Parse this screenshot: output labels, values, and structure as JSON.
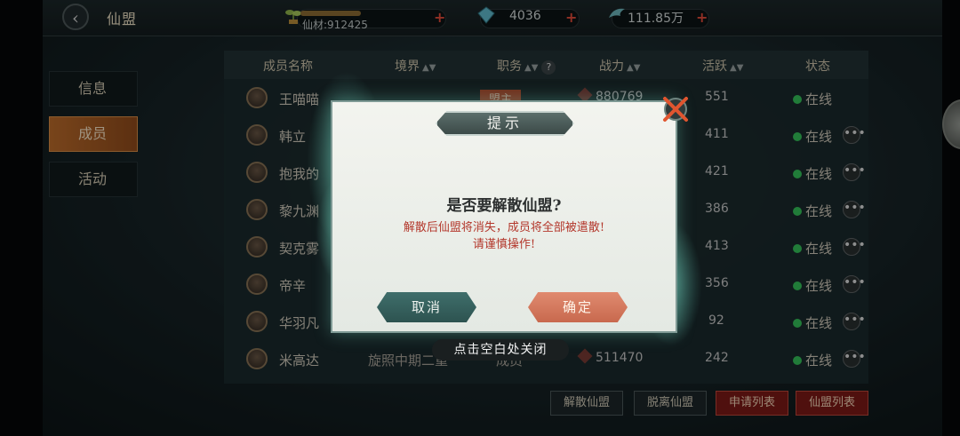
{
  "header": {
    "title": "仙盟",
    "resources": [
      {
        "name": "仙材",
        "value": "仙材:912425",
        "icon": "sprout-icon"
      },
      {
        "name": "gems",
        "value": "4036",
        "icon": "gem-icon"
      },
      {
        "name": "coins",
        "value": "111.85万",
        "icon": "wing-icon"
      }
    ],
    "plus": "+"
  },
  "tabs": [
    {
      "label": "信息",
      "active": false
    },
    {
      "label": "成员",
      "active": true
    },
    {
      "label": "活动",
      "active": false
    }
  ],
  "table": {
    "headers": {
      "name": "成员名称",
      "realm": "境界",
      "role": "职务",
      "power": "战力",
      "active": "活跃",
      "status": "状态"
    },
    "rows": [
      {
        "name": "王喵喵",
        "realm": "",
        "role": "盟主",
        "power": "880769",
        "active": "551",
        "status": "在线",
        "more": false
      },
      {
        "name": "韩立",
        "realm": "",
        "role": "",
        "power": "",
        "active": "411",
        "status": "在线",
        "more": true
      },
      {
        "name": "抱我的",
        "realm": "",
        "role": "",
        "power": "",
        "active": "421",
        "status": "在线",
        "more": true
      },
      {
        "name": "黎九渊",
        "realm": "",
        "role": "",
        "power": "",
        "active": "386",
        "status": "在线",
        "more": true
      },
      {
        "name": "契克雾",
        "realm": "",
        "role": "",
        "power": "",
        "active": "413",
        "status": "在线",
        "more": true
      },
      {
        "name": "帝辛",
        "realm": "",
        "role": "",
        "power": "",
        "active": "356",
        "status": "在线",
        "more": true
      },
      {
        "name": "华羽凡",
        "realm": "",
        "role": "",
        "power": "",
        "active": "92",
        "status": "在线",
        "more": true
      },
      {
        "name": "米高达",
        "realm": "旋照中期二重",
        "role": "成员",
        "power": "511470",
        "active": "242",
        "status": "在线",
        "more": true
      }
    ]
  },
  "bottom_buttons": [
    "解散仙盟",
    "脱离仙盟",
    "申请列表",
    "仙盟列表"
  ],
  "dialog": {
    "title": "提示",
    "question": "是否要解散仙盟?",
    "warning_line1": "解散后仙盟将消失，成员将全部被遣散!",
    "warning_line2": "请谨慎操作!",
    "cancel": "取消",
    "confirm": "确定",
    "close_hint": "点击空白处关闭"
  },
  "colors": {
    "accent": "#b96a2a",
    "online": "#35c45a",
    "danger": "#b3372b"
  }
}
